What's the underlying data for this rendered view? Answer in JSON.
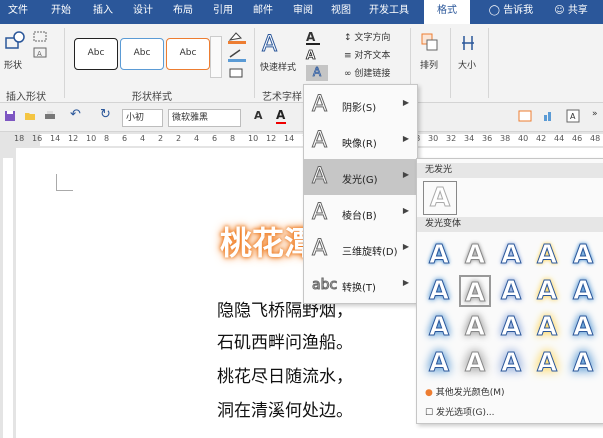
{
  "ribbon_tabs": [
    "文件",
    "开始",
    "插入",
    "设计",
    "布局",
    "引用",
    "邮件",
    "审阅",
    "视图",
    "开发工具",
    "格式"
  ],
  "tell_me": "告诉我",
  "share": "共享",
  "groups": {
    "insert_shapes": "插入形状",
    "shape_styles": "形状样式",
    "art_text": "艺术字样",
    "arrange": "排列",
    "size": "大小"
  },
  "shape_button": "形状",
  "style_sample": "Abc",
  "quick_styles": "快速样式",
  "text_direction": "文字方向",
  "align_text": "对齐文本",
  "create_link": "创建链接",
  "arrange_label": "排列",
  "size_label": "大小",
  "qat": {
    "font_size": "小初",
    "font_name": "微软雅黑"
  },
  "ruler_numbers": [
    "18",
    "16",
    "14",
    "12",
    "10",
    "8",
    "6",
    "4",
    "2",
    "2",
    "4",
    "6",
    "8",
    "10",
    "12",
    "14",
    "16",
    "18",
    "20",
    "22",
    "24",
    "26",
    "28",
    "30",
    "32",
    "34",
    "36",
    "38",
    "40",
    "42",
    "44",
    "46",
    "48"
  ],
  "title_text": "桃花潭",
  "poem_lines": [
    "隐隐飞桥隔野烟，",
    "石矶西畔问渔船。",
    "桃花尽日随流水，",
    "洞在清溪何处边。"
  ],
  "menu_items": [
    {
      "label": "阴影(S)",
      "icon": "A"
    },
    {
      "label": "映像(R)",
      "icon": "A"
    },
    {
      "label": "发光(G)",
      "icon": "A"
    },
    {
      "label": "棱台(B)",
      "icon": "A"
    },
    {
      "label": "三维旋转(D)",
      "icon": "A"
    },
    {
      "label": "转换(T)",
      "icon": "abc"
    }
  ],
  "glow": {
    "none_header": "无发光",
    "variants_header": "发光变体",
    "more_colors": "其他发光颜色(M)",
    "options": "发光选项(G)...",
    "colors": [
      "#5b9bd5",
      "#a5a5a5",
      "#8faadc",
      "#ffd966",
      "#5b9bd5"
    ]
  }
}
